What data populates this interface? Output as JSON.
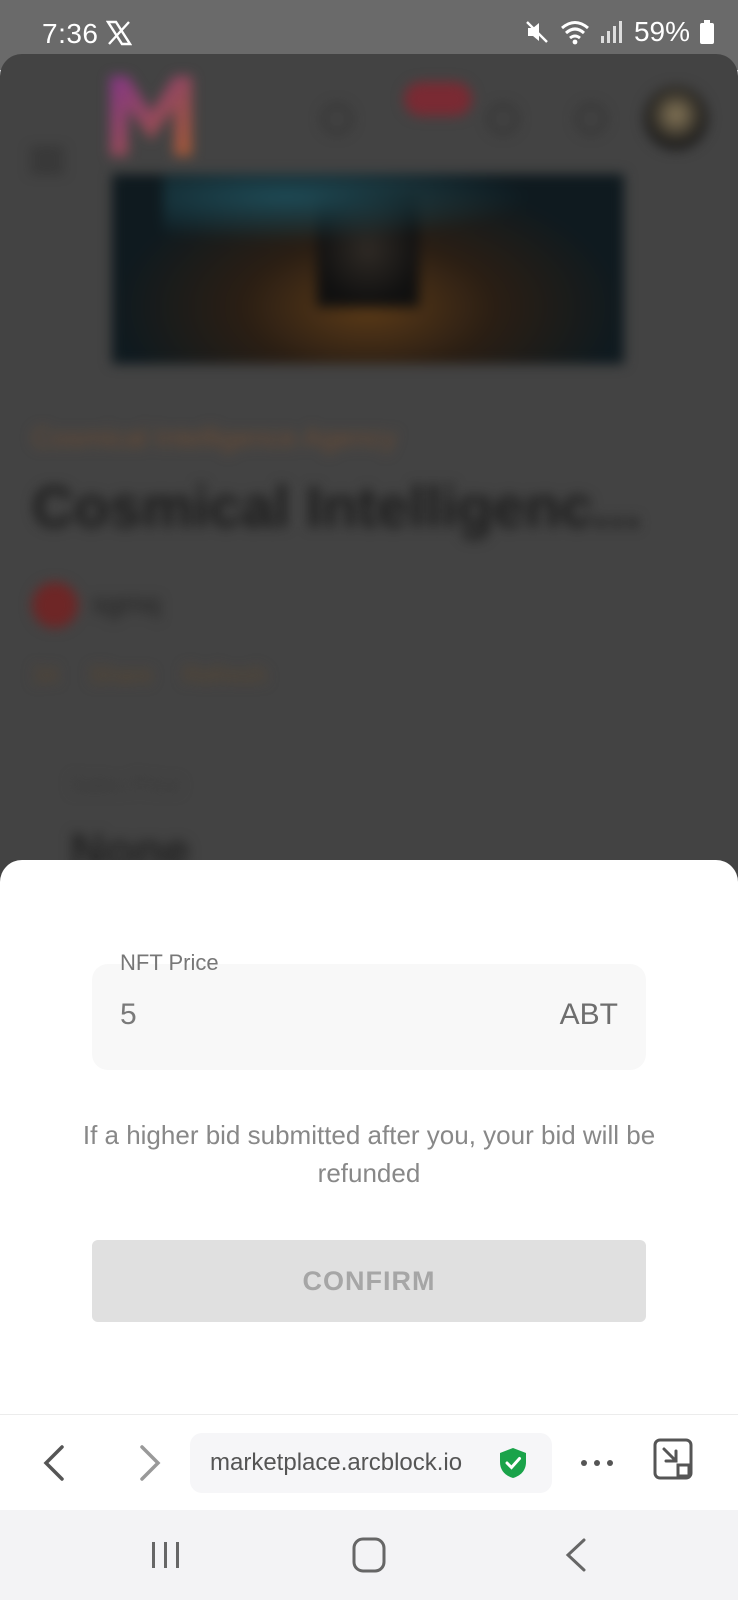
{
  "status_bar": {
    "time": "7:36",
    "battery": "59%",
    "icons": [
      "x-app-icon",
      "mute-icon",
      "wifi-icon",
      "signal-icon",
      "battery-icon"
    ]
  },
  "background_page": {
    "collection": "Cosmical Intelligence Agency",
    "title": "Cosmical Intelligenc...",
    "owner": "sgmq",
    "views": "34",
    "share_label": "Share",
    "refresh_label": "Refresh",
    "price_label": "Sales Price",
    "price_value": "None"
  },
  "sheet": {
    "field_label": "NFT Price",
    "price_value": "5",
    "currency": "ABT",
    "hint": "If a higher bid submitted after you, your bid will be refunded",
    "confirm_label": "CONFIRM"
  },
  "browser": {
    "url": "marketplace.arcblock.io",
    "secure_color": "#1aa34a"
  }
}
